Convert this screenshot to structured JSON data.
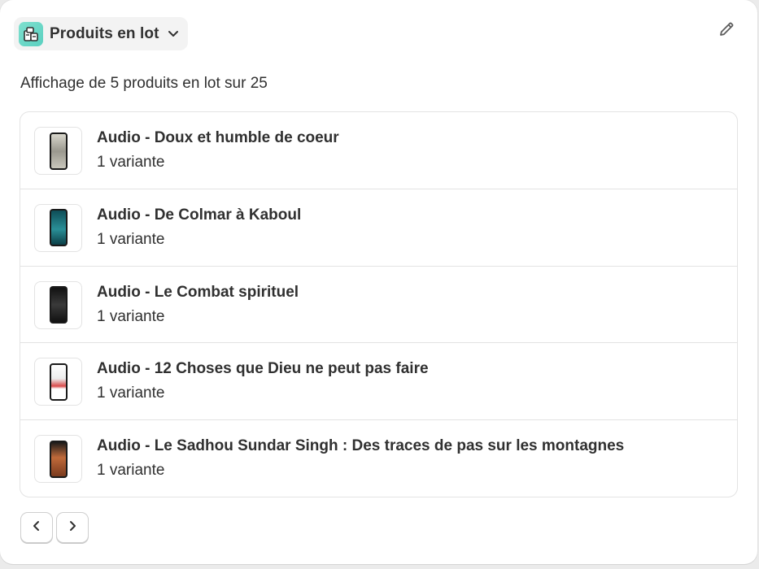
{
  "header": {
    "title": "Produits en lot",
    "app_icon": "bundle-app-icon",
    "accent": "#5ad0c0"
  },
  "summary": "Affichage de 5 produits en lot sur 25",
  "products": [
    {
      "title": "Audio - Doux et humble de coeur",
      "subtitle": "1 variante",
      "thumb_color": "#b9b7ad"
    },
    {
      "title": "Audio - De Colmar à Kaboul",
      "subtitle": "1 variante",
      "thumb_color": "#1f6f78"
    },
    {
      "title": "Audio - Le Combat spirituel",
      "subtitle": "1 variante",
      "thumb_color": "#2a2a2a"
    },
    {
      "title": "Audio - 12 Choses que Dieu ne peut pas faire",
      "subtitle": "1 variante",
      "thumb_color": "#f4f4f4"
    },
    {
      "title": "Audio - Le Sadhou Sundar Singh : Des traces de pas sur les montagnes",
      "subtitle": "1 variante",
      "thumb_color": "#8a4b2a"
    }
  ],
  "pagination": {
    "prev_icon": "chevron-left-icon",
    "next_icon": "chevron-right-icon"
  },
  "edit_icon": "pencil-icon"
}
